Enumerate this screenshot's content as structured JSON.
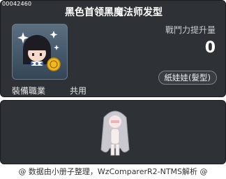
{
  "tooltip": {
    "item_id": "00042460",
    "item_name": "黑色首领黑魔法师发型",
    "combat_power_label": "戰鬥力提升量",
    "combat_power_value": "0",
    "category_badge": "紙娃娃(髮型)",
    "job_label": "裝備職業",
    "job_value": "共用",
    "icon": "hairstyle-icon",
    "preview_icon": "character-preview"
  },
  "footer": {
    "text": "@ 数据由小册子整理，WzComparerR2-NTMS解析 @"
  },
  "colors": {
    "panel_bg": "#2e3135",
    "text_white": "#ffffff",
    "text_gray": "#c8cbd0"
  }
}
